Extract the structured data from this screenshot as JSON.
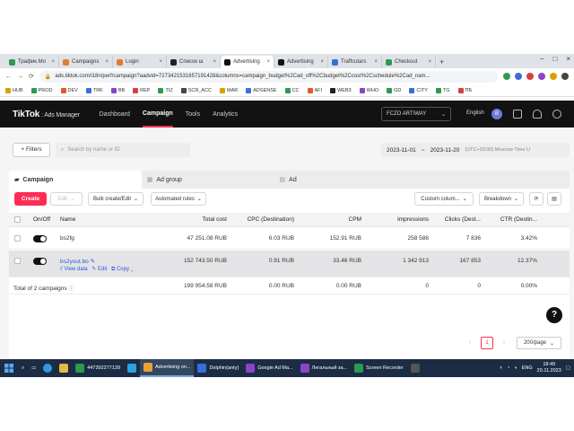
{
  "browser": {
    "tabs": [
      {
        "label": "Трафик.Мо",
        "color": "#2e9a4f"
      },
      {
        "label": "Campaigns",
        "color": "#e37b2d"
      },
      {
        "label": "Login",
        "color": "#e37b2d"
      },
      {
        "label": "Список ш",
        "color": "#202124"
      },
      {
        "label": "Advertising",
        "color": "#111111"
      },
      {
        "label": "Advertising",
        "color": "#111111"
      },
      {
        "label": "Traffcutars",
        "color": "#3a6fd8"
      },
      {
        "label": "Checkout",
        "color": "#2e9a4f"
      }
    ],
    "active_tab_index": 4,
    "new_tab": "+",
    "url": "ads.tiktok.com/i18n/perf/campaign?aadvid=7273421531657191428&columns=campaign_budget%2Cad_off%2Cbudget%2Ccost%2Cschedule%2Cad_nam...",
    "bookmarks": [
      "HUB",
      "PROD",
      "DEV",
      "TRK",
      "BB",
      "REP",
      "TIZ",
      "SCR_ACC",
      "MAR",
      "ADSENSE",
      "CC",
      "AFI",
      "WEB3",
      "WHO",
      "GD",
      "CITY",
      "TG",
      "ПБ"
    ],
    "bookmark_colors": [
      "#d8a200",
      "#2e9a4f",
      "#e05a2a",
      "#3a6fd8",
      "#8a44c8",
      "#d84040",
      "#2e9a4f",
      "#444444",
      "#d8a200",
      "#3a6fd8",
      "#2e9a4f",
      "#e05a2a",
      "#202124",
      "#8a44c8",
      "#2e9a4f",
      "#3a6fd8",
      "#2e9a4f",
      "#d84040"
    ],
    "window_controls": [
      "−",
      "□",
      "×"
    ]
  },
  "tiktok": {
    "logo": "TikTok",
    "logo_sub": ": Ads Manager",
    "nav": [
      "Dashboard",
      "Campaign",
      "Tools",
      "Analytics"
    ],
    "active_nav": "Campaign",
    "account": "FCZO ARTIWAY",
    "language": "English",
    "avatar_letter": "B"
  },
  "filters": {
    "button": "+ Filters",
    "search_placeholder": "Search by name or ID",
    "date_start": "2023-11-01",
    "date_sep": "~",
    "date_end": "2023-11-20",
    "timezone": "(UTC+03:00) Moscow Time U"
  },
  "levels": {
    "campaign": "Campaign",
    "adgroup": "Ad group",
    "ad": "Ad"
  },
  "toolbar": {
    "create": "Create",
    "edit": "Edit",
    "bulk": "Bulk create/Edit",
    "rules": "Automated rules",
    "custom_columns": "Custom colum...",
    "breakdown": "Breakdown"
  },
  "table": {
    "headers": {
      "onoff": "On/Off",
      "name": "Name",
      "total_cost": "Total cost",
      "cpc": "CPC (Destination)",
      "cpm": "CPM",
      "impressions": "Impressions",
      "clicks": "Clicks (Dest...",
      "ctr": "CTR (Destin..."
    },
    "rows": [
      {
        "name": "bs2fg",
        "total_cost": "47 251.08 RUB",
        "cpc": "6.03 RUB",
        "cpm": "152.91 RUB",
        "impressions": "258 588",
        "clicks": "7 836",
        "ctr": "3.42%"
      },
      {
        "name": "bs2yout.bo",
        "total_cost": "152 743.50 RUB",
        "cpc": "0.91 RUB",
        "cpm": "33.46 RUB",
        "impressions": "1 342 913",
        "clicks": "167 853",
        "ctr": "12.37%",
        "actions": {
          "view": "View data",
          "edit": "Edit",
          "copy": "Copy"
        }
      }
    ],
    "total": {
      "label": "Total of 2 campaigns",
      "total_cost": "199 954.58 RUB",
      "cpc": "0.00 RUB",
      "cpm": "0.00 RUB",
      "impressions": "0",
      "clicks": "0",
      "ctr": "0.00%"
    }
  },
  "pagination": {
    "prev": "‹",
    "current": "1",
    "next": "›",
    "page_size": "200/page"
  },
  "help": "?",
  "taskbar": {
    "items": [
      {
        "label": "447392277139",
        "color": "#2e9a4f",
        "active": false
      },
      {
        "label": "",
        "color": "#2aa3df",
        "active": false
      },
      {
        "label": "Advertising on...",
        "color": "#e8a23a",
        "active": true
      },
      {
        "label": "Dolphin{anty}",
        "color": "#3a6fd8",
        "active": false
      },
      {
        "label": "Google Ad Ma...",
        "color": "#8a44c8",
        "active": false
      },
      {
        "label": "Легальный за...",
        "color": "#8a44c8",
        "active": false
      },
      {
        "label": "Screen Recorder",
        "color": "#2e9a4f",
        "active": false
      },
      {
        "label": "",
        "color": "#555555",
        "active": false
      }
    ],
    "lang": "ENG",
    "time": "18:49",
    "date": "20.11.2023"
  }
}
